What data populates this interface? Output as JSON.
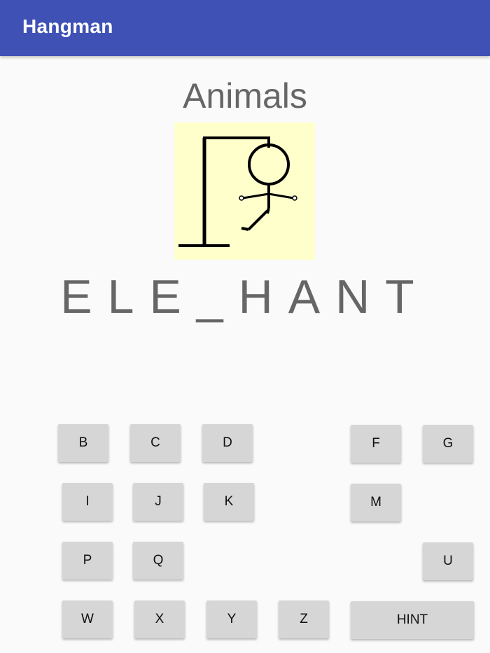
{
  "app_bar": {
    "title": "Hangman",
    "color": "#3f51b5"
  },
  "game": {
    "category": "Animals",
    "word_display": "ELE_HANT",
    "gallows_background": "#ffffcc"
  },
  "keyboard": {
    "rows": [
      [
        "B",
        "C",
        "D",
        "F",
        "G"
      ],
      [
        "I",
        "J",
        "K",
        "M"
      ],
      [
        "P",
        "Q",
        "U"
      ],
      [
        "W",
        "X",
        "Y",
        "Z"
      ]
    ],
    "hint_label": "HINT"
  }
}
